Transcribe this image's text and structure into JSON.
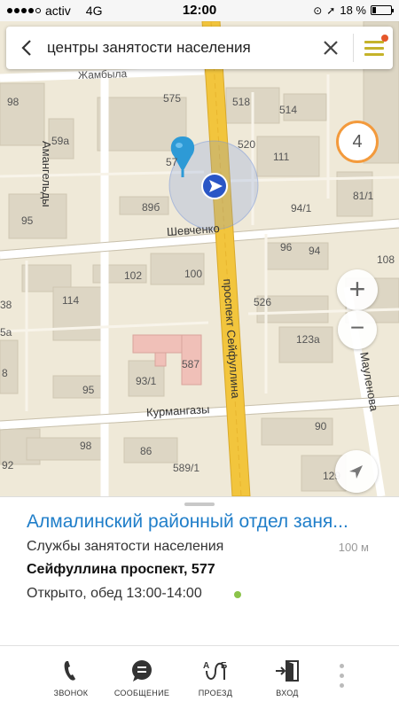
{
  "status_bar": {
    "carrier": "activ",
    "network": "4G",
    "time": "12:00",
    "battery": "18 %",
    "battery_level": 0.18
  },
  "search": {
    "query": "центры занятости населения"
  },
  "map": {
    "result_count": "4",
    "streets": {
      "shevchenko": "Шевченко",
      "kurmangazy": "Курмангазы",
      "seifullina": "проспект Сейфуллина",
      "mailenova": "Мауленова",
      "amangeldy": "Амангельды",
      "zhambyla": "Жамбыла"
    },
    "buildings": [
      "98",
      "575",
      "518",
      "514",
      "59а",
      "520",
      "111",
      "89б",
      "94/1",
      "81/1",
      "95",
      "96",
      "94",
      "108",
      "102",
      "100",
      "114",
      "526",
      "123а",
      "587",
      "93/1",
      "95",
      "98",
      "90",
      "86",
      "589/1",
      "129",
      "92",
      "5а",
      "8",
      "38",
      "57"
    ]
  },
  "card": {
    "title": "Алмалинский районный отдел заня...",
    "category": "Службы занятости населения",
    "distance": "100 м",
    "address": "Сейфуллина проспект, 577",
    "hours": "Открыто, обед 13:00-14:00"
  },
  "actions": {
    "call": "ЗВОНОК",
    "message": "СООБЩЕНИЕ",
    "route": "ПРОЕЗД",
    "entrance": "ВХОД"
  },
  "colors": {
    "accent_blue": "#1f7ec9",
    "avenue_yellow": "#f2c53d",
    "cluster_orange": "#f39a3c",
    "open_green": "#8bc34a"
  }
}
